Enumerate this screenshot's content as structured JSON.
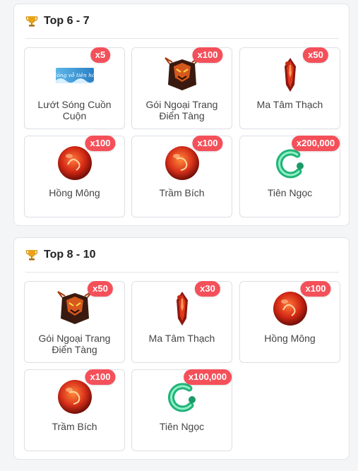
{
  "sections": [
    {
      "title": "Top 6 - 7",
      "icon": "trophy-icon",
      "items": [
        {
          "label": "Lướt Sóng Cuồn Cuộn",
          "qty": "x5",
          "icon": "wave-banner-icon",
          "logo_text": "Sóng vỗ tiên hồi"
        },
        {
          "label": "Gói Ngoại Trang Điển Tàng",
          "qty": "x100",
          "icon": "demon-chest-icon"
        },
        {
          "label": "Ma Tâm Thạch",
          "qty": "x50",
          "icon": "red-crystal-icon"
        },
        {
          "label": "Hồng Mông",
          "qty": "x100",
          "icon": "red-orb-icon"
        },
        {
          "label": "Trầm Bích",
          "qty": "x100",
          "icon": "red-orb-icon"
        },
        {
          "label": "Tiên Ngọc",
          "qty": "x200,000",
          "icon": "jade-swirl-icon"
        }
      ]
    },
    {
      "title": "Top 8 - 10",
      "icon": "trophy-icon",
      "items": [
        {
          "label": "Gói Ngoại Trang Điển Tàng",
          "qty": "x50",
          "icon": "demon-chest-icon"
        },
        {
          "label": "Ma Tâm Thạch",
          "qty": "x30",
          "icon": "red-crystal-icon"
        },
        {
          "label": "Hồng Mông",
          "qty": "x100",
          "icon": "red-orb-icon"
        },
        {
          "label": "Trầm Bích",
          "qty": "x100",
          "icon": "red-orb-icon"
        },
        {
          "label": "Tiên Ngọc",
          "qty": "x100,000",
          "icon": "jade-swirl-icon"
        }
      ]
    }
  ],
  "colors": {
    "badge": "#f4505a",
    "panel_border": "#e2e4e8",
    "card_border": "#dcdfe4"
  }
}
